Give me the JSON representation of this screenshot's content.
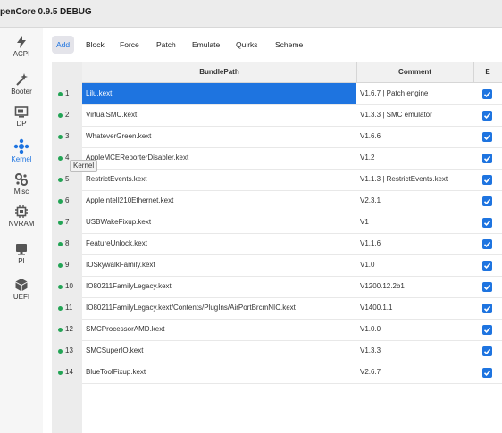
{
  "window": {
    "title": "penCore 0.9.5 DEBUG"
  },
  "sidebar": {
    "items": [
      {
        "label": "ACPI",
        "icon": "bolt-icon"
      },
      {
        "label": "Booter",
        "icon": "wand-icon"
      },
      {
        "label": "DP",
        "icon": "monitor-icon"
      },
      {
        "label": "Kernel",
        "icon": "kernel-icon",
        "active": true
      },
      {
        "label": "Misc",
        "icon": "gears-icon"
      },
      {
        "label": "NVRAM",
        "icon": "chip-icon"
      },
      {
        "label": "PI",
        "icon": "screen-icon"
      },
      {
        "label": "UEFI",
        "icon": "box-icon"
      }
    ]
  },
  "tooltip": {
    "text": "Kernel"
  },
  "tabs": [
    {
      "label": "Add",
      "active": true
    },
    {
      "label": "Block"
    },
    {
      "label": "Force"
    },
    {
      "label": "Patch"
    },
    {
      "label": "Emulate"
    },
    {
      "label": "Quirks"
    },
    {
      "label": "Scheme"
    }
  ],
  "table": {
    "columns": {
      "path": "BundlePath",
      "comment": "Comment",
      "enabled": "E"
    },
    "rows": [
      {
        "num": "1",
        "path": "Lilu.kext",
        "comment": "V1.6.7 | Patch engine",
        "enabled": true,
        "selected": true
      },
      {
        "num": "2",
        "path": "VirtualSMC.kext",
        "comment": "V1.3.3 | SMC emulator",
        "enabled": true
      },
      {
        "num": "3",
        "path": "WhateverGreen.kext",
        "comment": "V1.6.6",
        "enabled": true
      },
      {
        "num": "4",
        "path": "AppleMCEReporterDisabler.kext",
        "comment": "V1.2",
        "enabled": true
      },
      {
        "num": "5",
        "path": "RestrictEvents.kext",
        "comment": "V1.1.3 | RestrictEvents.kext",
        "enabled": true
      },
      {
        "num": "6",
        "path": "AppleIntelI210Ethernet.kext",
        "comment": "V2.3.1",
        "enabled": true
      },
      {
        "num": "7",
        "path": "USBWakeFixup.kext",
        "comment": "V1",
        "enabled": true
      },
      {
        "num": "8",
        "path": "FeatureUnlock.kext",
        "comment": "V1.1.6",
        "enabled": true
      },
      {
        "num": "9",
        "path": "IOSkywalkFamily.kext",
        "comment": "V1.0",
        "enabled": true
      },
      {
        "num": "10",
        "path": "IO80211FamilyLegacy.kext",
        "comment": "V1200.12.2b1",
        "enabled": true
      },
      {
        "num": "11",
        "path": "IO80211FamilyLegacy.kext/Contents/PlugIns/AirPortBrcmNIC.kext",
        "comment": "V1400.1.1",
        "enabled": true
      },
      {
        "num": "12",
        "path": "SMCProcessorAMD.kext",
        "comment": "V1.0.0",
        "enabled": true
      },
      {
        "num": "13",
        "path": "SMCSuperIO.kext",
        "comment": "V1.3.3",
        "enabled": true
      },
      {
        "num": "14",
        "path": "BlueToolFixup.kext",
        "comment": "V2.6.7",
        "enabled": true
      }
    ]
  },
  "colors": {
    "accent": "#1e74e0",
    "status_dot": "#23a455"
  }
}
